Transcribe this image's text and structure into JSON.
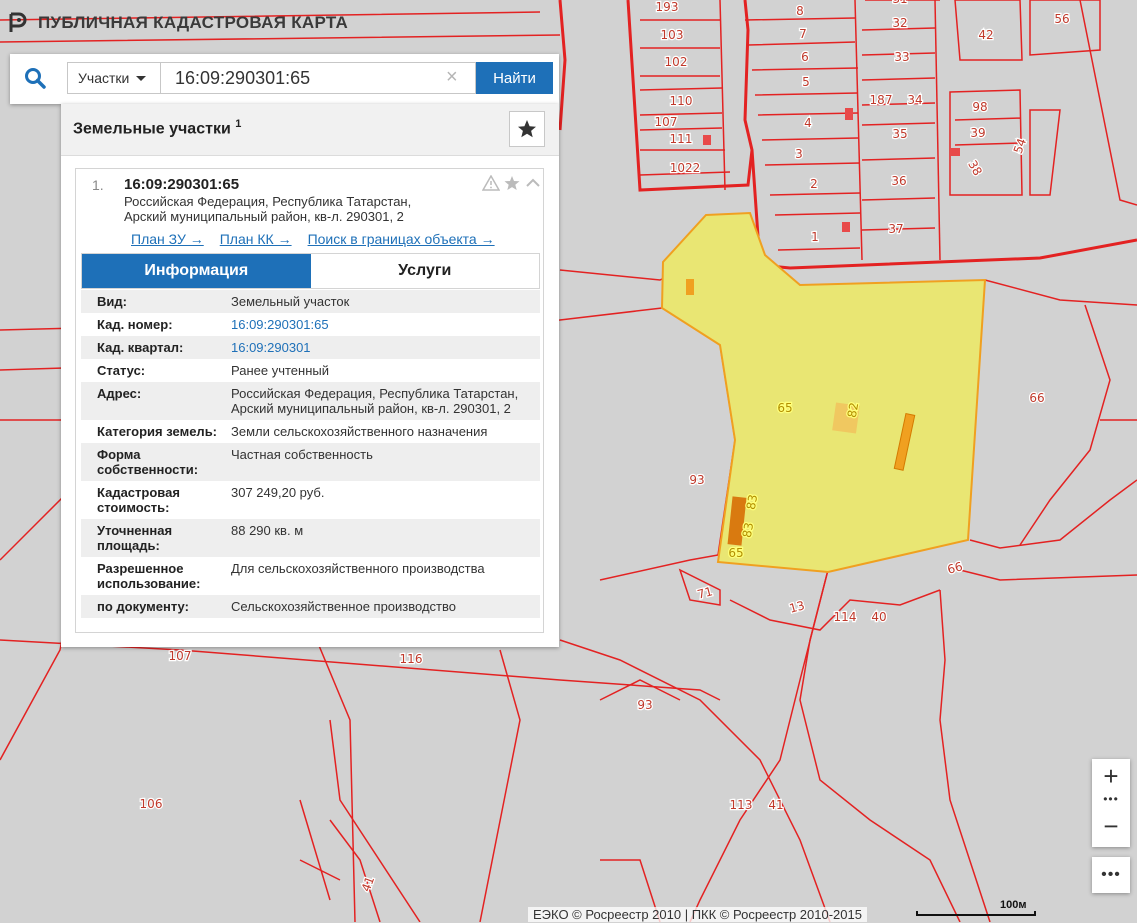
{
  "app": {
    "title": "ПУБЛИЧНАЯ КАДАСТРОВАЯ КАРТА"
  },
  "search": {
    "type_label": "Участки",
    "value": "16:09:290301:65",
    "button_label": "Найти"
  },
  "panel": {
    "title": "Земельные участки",
    "count": "1"
  },
  "result": {
    "index": "1.",
    "cad_number": "16:09:290301:65",
    "address": "Российская Федерация, Республика Татарстан, Арский муниципальный район, кв-л. 290301, 2",
    "links": [
      "План ЗУ →",
      "План КК →",
      "Поиск в границах объекта →"
    ],
    "tabs": [
      "Информация",
      "Услуги"
    ],
    "fields": [
      {
        "key": "Вид:",
        "value": "Земельный участок"
      },
      {
        "key": "Кад. номер:",
        "value": "16:09:290301:65"
      },
      {
        "key": "Кад. квартал:",
        "value": "16:09:290301"
      },
      {
        "key": "Статус:",
        "value": "Ранее учтенный"
      },
      {
        "key": "Адрес:",
        "value": "Российская Федерация, Республика Татарстан, Арский муниципальный район, кв-л. 290301, 2"
      },
      {
        "key": "Категория земель:",
        "value": "Земли сельскохозяйственного назначения"
      },
      {
        "key": "Форма собственности:",
        "value": "Частная собственность"
      },
      {
        "key": "Кадастровая стоимость:",
        "value": "307 249,20 руб."
      },
      {
        "key": "Уточненная площадь:",
        "value": "88 290 кв. м"
      },
      {
        "key": "Разрешенное использование:",
        "value": "Для сельскохозяйственного производства"
      },
      {
        "key": "по документу:",
        "value": "Сельскохозяйственное производство"
      }
    ]
  },
  "map": {
    "parcel_labels": [
      "193",
      "103",
      "102",
      "110",
      "107",
      "111",
      "1022",
      "8",
      "7",
      "6",
      "5",
      "4",
      "3",
      "2",
      "1",
      "31",
      "32",
      "33",
      "187",
      "34",
      "35",
      "36",
      "37",
      "42",
      "56",
      "98",
      "39",
      "38",
      "54",
      "65",
      "82",
      "83",
      "93",
      "66",
      "71",
      "13",
      "114",
      "40",
      "107",
      "116",
      "93",
      "106",
      "113",
      "41",
      "41",
      "1"
    ],
    "colors": {
      "boundary": "#e32222",
      "parcel_fill": "#e9e673",
      "parcel_edge": "#f0a020",
      "building": "#f0a020"
    }
  },
  "controls": {
    "zoom_in": "+",
    "zoom_out": "−",
    "menu": "•••"
  },
  "attribution": "ЕЭКО © Росреестр 2010 | ПКК © Росреестр 2010-2015",
  "scale": "100м"
}
